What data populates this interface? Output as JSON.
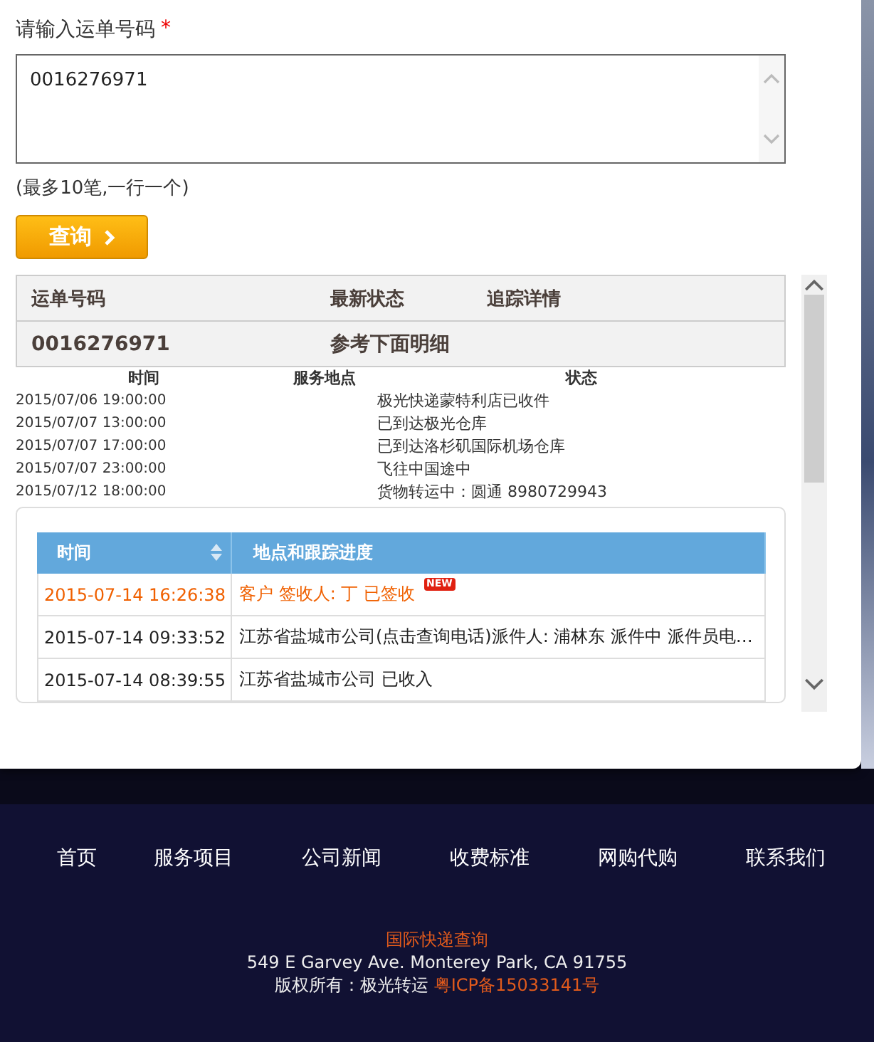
{
  "form": {
    "label": "请输入运单号码",
    "required_mark": "*",
    "value": "0016276971",
    "hint": "(最多10笔,一行一个)",
    "button": "查询"
  },
  "summary": {
    "columns": [
      "运单号码",
      "最新状态",
      "追踪详情"
    ],
    "row": [
      "0016276971",
      "参考下面明细"
    ]
  },
  "events": {
    "columns": [
      "时间",
      "服务地点",
      "状态"
    ],
    "rows": [
      {
        "time": "2015/07/06 19:00:00",
        "status": "极光快递蒙特利店已收件"
      },
      {
        "time": "2015/07/07 13:00:00",
        "status": "已到达极光仓库"
      },
      {
        "time": "2015/07/07 17:00:00",
        "status": "已到达洛杉矶国际机场仓库"
      },
      {
        "time": "2015/07/07 23:00:00",
        "status": "飞往中国途中"
      },
      {
        "time": "2015/07/12 18:00:00",
        "status": "货物转运中：圆通 8980729943"
      }
    ]
  },
  "tracking": {
    "columns": [
      "时间",
      "地点和跟踪进度"
    ],
    "rows": [
      {
        "time": "2015-07-14 16:26:38",
        "detail": "客户 签收人: 丁 已签收",
        "latest": true,
        "badge": "NEW"
      },
      {
        "time": "2015-07-14 09:33:52",
        "detail": "江苏省盐城市公司(点击查询电话)派件人: 浦林东 派件中 派件员电…",
        "latest": false
      },
      {
        "time": "2015-07-14 08:39:55",
        "detail": "江苏省盐城市公司 已收入",
        "latest": false
      }
    ]
  },
  "footer": {
    "nav": [
      "首页",
      "服务项目",
      "公司新闻",
      "收费标准",
      "网购代购",
      "联系我们"
    ],
    "title": "国际快递查询",
    "address": "549 E Garvey Ave. Monterey Park, CA 91755",
    "copyright": "版权所有：极光转运",
    "icp": "粤ICP备15033141号"
  }
}
